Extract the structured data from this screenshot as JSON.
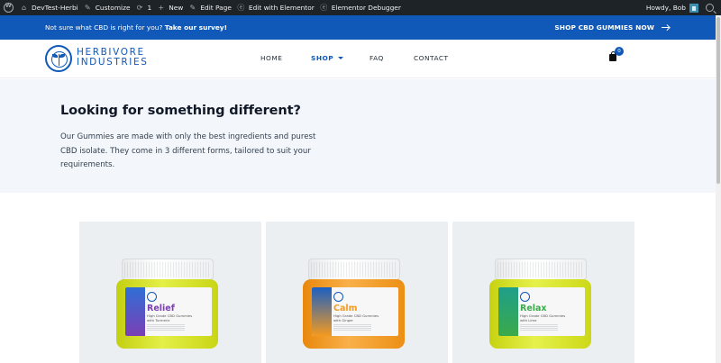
{
  "adminbar": {
    "site_name": "DevTest-Herbi",
    "customize": "Customize",
    "updates_count": "1",
    "new": "New",
    "edit_page": "Edit Page",
    "edit_elementor": "Edit with Elementor",
    "elementor_debugger": "Elementor Debugger",
    "greeting": "Howdy, Bob"
  },
  "promo": {
    "text": "Not sure what CBD is right for you?",
    "link": "Take our survey!",
    "cta": "SHOP CBD GUMMIES NOW"
  },
  "header": {
    "logo_line1": "HERBIVORE",
    "logo_line2": "INDUSTRIES",
    "nav": [
      "HOME",
      "SHOP",
      "FAQ",
      "CONTACT"
    ],
    "cart_count": "0"
  },
  "hero": {
    "title": "Looking for something different?",
    "body": "Our Gummies are made with only the best ingredients and purest CBD isolate. They come in 3 different forms, tailored to suit your requirements."
  },
  "products": [
    {
      "name": "Relief",
      "subtitle": "High Grade CBD Gummies with Turmeric",
      "jar_color": "#d3e01a",
      "accent": "#7b3fb5",
      "strip": "#2f6fd6"
    },
    {
      "name": "Calm",
      "subtitle": "High Grade CBD Gummies with Ginger",
      "jar_color": "#f39a1f",
      "accent": "#f39a1f",
      "strip": "#1b5fc4"
    },
    {
      "name": "Relax",
      "subtitle": "High Grade CBD Gummies with Lime",
      "jar_color": "#d6e21c",
      "accent": "#3aaa4a",
      "strip": "#1f9f8a"
    }
  ],
  "colors": {
    "brand": "#1159b8",
    "hero_bg": "#f3f7fb",
    "adminbar": "#1d2327"
  }
}
